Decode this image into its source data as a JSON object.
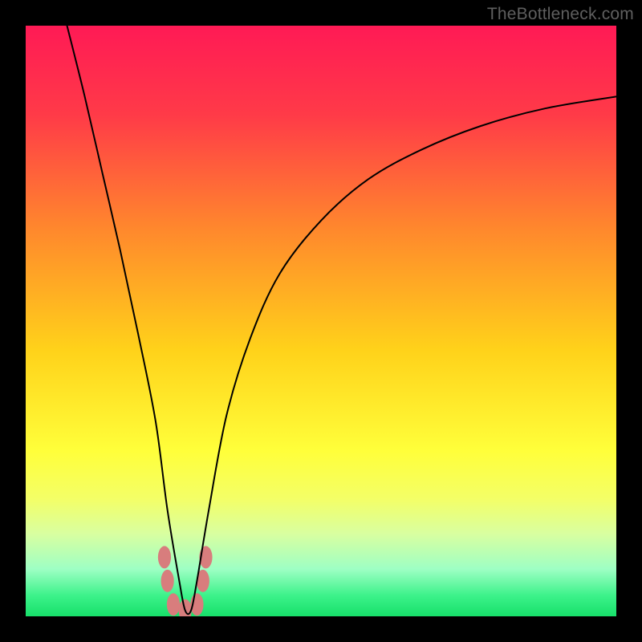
{
  "watermark": "TheBottleneck.com",
  "chart_data": {
    "type": "line",
    "title": "",
    "xlabel": "",
    "ylabel": "",
    "xlim": [
      0,
      100
    ],
    "ylim": [
      0,
      100
    ],
    "note": "V-shaped bottleneck curve. Background gradient encodes value: red (top, roughly 100) through orange/yellow to green (bottom, roughly 0). The black curve shows bottleneck percentage vs an implicit x-axis parameter; minimum (~0) occurs near x≈27. Axes and ticks are not drawn; values are estimated from vertical position against the gradient.",
    "gradient_stops": [
      {
        "pos": 0.0,
        "color": "#ff1a55"
      },
      {
        "pos": 0.15,
        "color": "#ff3a48"
      },
      {
        "pos": 0.35,
        "color": "#ff8a2c"
      },
      {
        "pos": 0.55,
        "color": "#ffd21a"
      },
      {
        "pos": 0.72,
        "color": "#ffff3a"
      },
      {
        "pos": 0.8,
        "color": "#f4ff66"
      },
      {
        "pos": 0.86,
        "color": "#d9ffa0"
      },
      {
        "pos": 0.92,
        "color": "#9effc4"
      },
      {
        "pos": 0.965,
        "color": "#3cf28a"
      },
      {
        "pos": 1.0,
        "color": "#17e06a"
      }
    ],
    "series": [
      {
        "name": "bottleneck-curve",
        "x": [
          7,
          10,
          13,
          16,
          19,
          22,
          24,
          26,
          27,
          28,
          29,
          31,
          34,
          38,
          43,
          50,
          58,
          67,
          77,
          88,
          100
        ],
        "y": [
          100,
          88,
          75,
          62,
          48,
          33,
          18,
          6,
          1,
          1,
          6,
          18,
          34,
          47,
          58,
          67,
          74,
          79,
          83,
          86,
          88
        ]
      }
    ],
    "markers": {
      "name": "highlight-blobs",
      "color": "#d87d7d",
      "points": [
        {
          "x": 23.5,
          "y": 10
        },
        {
          "x": 24.0,
          "y": 6
        },
        {
          "x": 25.0,
          "y": 2
        },
        {
          "x": 27.0,
          "y": 1
        },
        {
          "x": 29.0,
          "y": 2
        },
        {
          "x": 30.0,
          "y": 6
        },
        {
          "x": 30.5,
          "y": 10
        }
      ]
    }
  }
}
